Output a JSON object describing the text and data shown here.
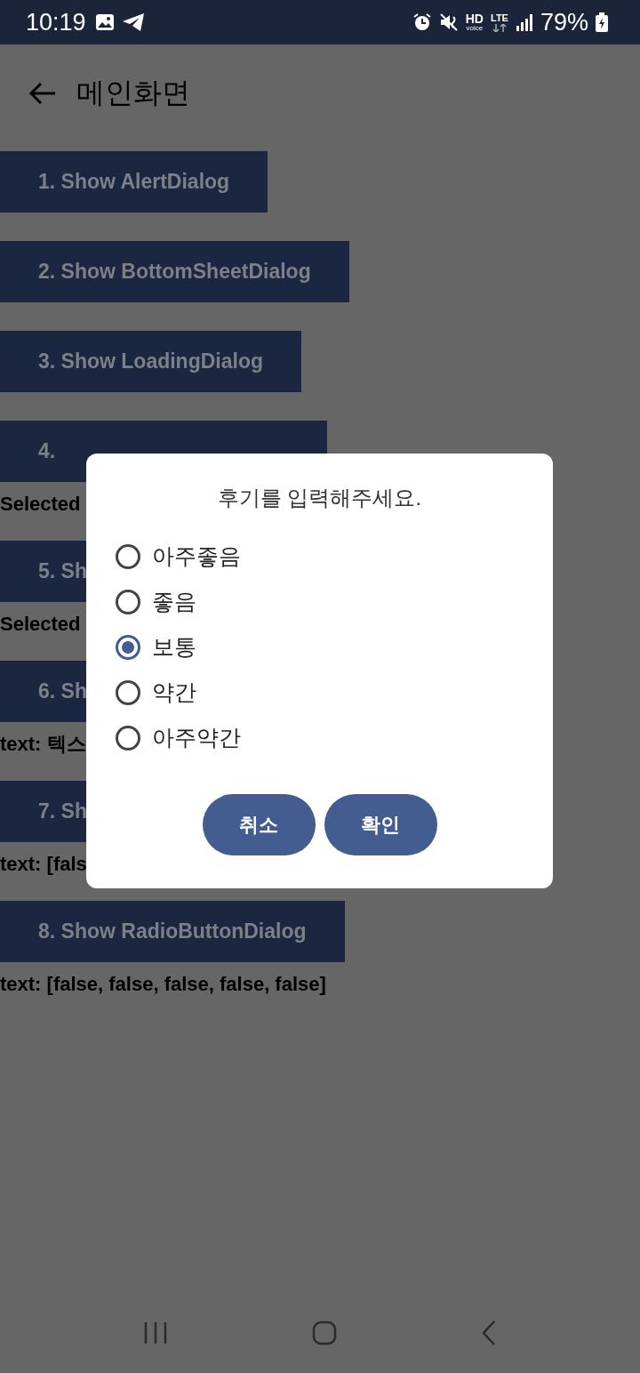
{
  "status_bar": {
    "time": "10:19",
    "hd": "HD",
    "voice": "voice",
    "lte": "LTE",
    "battery": "79%"
  },
  "app_bar": {
    "title": "메인화면"
  },
  "items": [
    {
      "kind": "button",
      "label": "1. Show AlertDialog"
    },
    {
      "kind": "button",
      "label": "2. Show BottomSheetDialog"
    },
    {
      "kind": "button",
      "label": "3. Show LoadingDialog"
    },
    {
      "kind": "button",
      "label": "4."
    },
    {
      "kind": "text",
      "label": "Selected"
    },
    {
      "kind": "button",
      "label": "5. Sh"
    },
    {
      "kind": "text",
      "label": "Selected"
    },
    {
      "kind": "button",
      "label": "6. Sh"
    },
    {
      "kind": "text",
      "label": "text: 텍스"
    },
    {
      "kind": "button",
      "label": "7. Sh"
    },
    {
      "kind": "text",
      "label": "text: [fals"
    },
    {
      "kind": "button",
      "label": "8. Show RadioButtonDialog"
    },
    {
      "kind": "text",
      "label": "text: [false, false, false, false, false]"
    }
  ],
  "dialog": {
    "title": "후기를 입력해주세요.",
    "options": [
      {
        "label": "아주좋음",
        "selected": false
      },
      {
        "label": "좋음",
        "selected": false
      },
      {
        "label": "보통",
        "selected": true
      },
      {
        "label": "약간",
        "selected": false
      },
      {
        "label": "아주약간",
        "selected": false
      }
    ],
    "buttons": [
      "취소",
      "확인"
    ]
  }
}
